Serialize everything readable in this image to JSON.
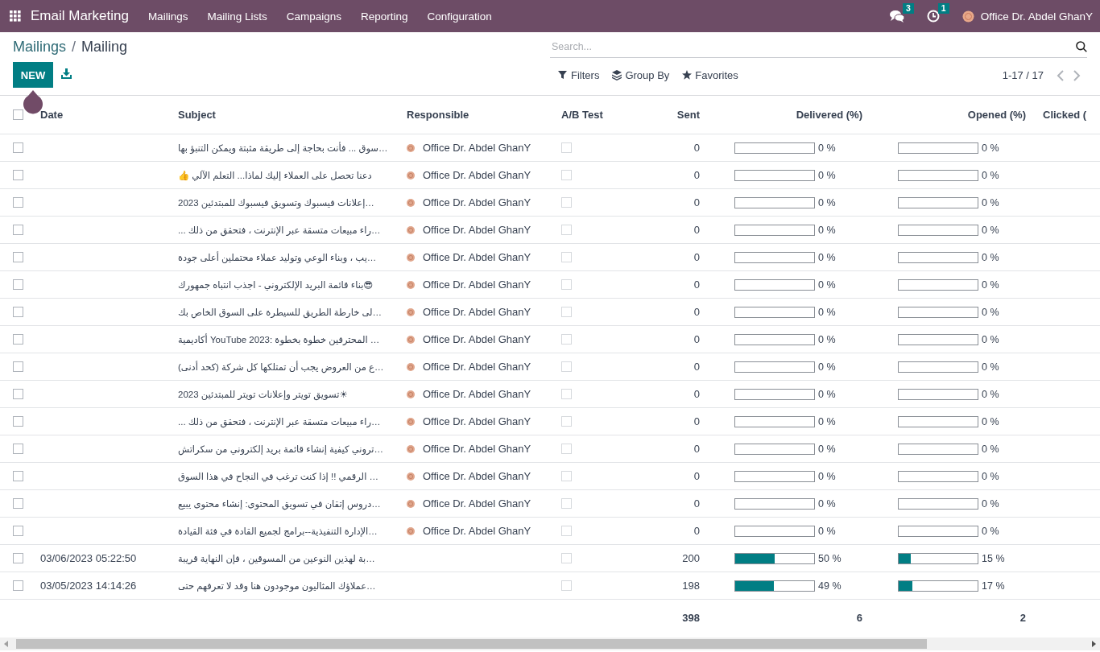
{
  "app": {
    "name": "Email Marketing"
  },
  "menu": [
    "Mailings",
    "Mailing Lists",
    "Campaigns",
    "Reporting",
    "Configuration"
  ],
  "systray": {
    "messages_count": "3",
    "activities_count": "1",
    "user": "Office Dr. Abdel GhanY"
  },
  "breadcrumb": {
    "parent": "Mailings",
    "separator": "/",
    "current": "Mailing"
  },
  "new_button": "NEW",
  "search": {
    "placeholder": "Search..."
  },
  "search_options": [
    {
      "kind": "filter",
      "label": "Filters"
    },
    {
      "kind": "group",
      "label": "Group By"
    },
    {
      "kind": "favorite",
      "label": "Favorites"
    }
  ],
  "pager": "1-17 / 17",
  "table": {
    "header_selected": false,
    "columns": [
      "Date",
      "Subject",
      "Responsible",
      "A/B Test",
      "Sent",
      "Delivered (%)",
      "Opened (%)",
      "Clicked ("
    ],
    "rows": [
      {
        "selected": false,
        "subject": "…سوق ... فأنت بحاجة إلى طريقة مثبتة ويمكن التنبؤ بها",
        "responsible": "Office Dr. Abdel GhanY",
        "ab_test": false,
        "sent": "0",
        "delivered": {
          "level": 0,
          "text": "0 %"
        },
        "opened": {
          "level": 0,
          "text": "0 %"
        }
      },
      {
        "selected": false,
        "subject": "دعنا تحصل على العملاء إليك لماذا... التعلم الآلي 👍",
        "responsible": "Office Dr. Abdel GhanY",
        "ab_test": false,
        "sent": "0",
        "delivered": {
          "level": 0,
          "text": "0 %"
        },
        "opened": {
          "level": 0,
          "text": "0 %"
        }
      },
      {
        "selected": false,
        "subject": "…إعلانات فيسبوك وتسويق فيسبوك للمبتدئين 2023",
        "responsible": "Office Dr. Abdel GhanY",
        "ab_test": false,
        "sent": "0",
        "delivered": {
          "level": 0,
          "text": "0 %"
        },
        "opened": {
          "level": 0,
          "text": "0 %"
        }
      },
      {
        "selected": false,
        "subject": "…راء مبيعات متسقة عبر الإنترنت ، فتحقق من ذلك ...",
        "responsible": "Office Dr. Abdel GhanY",
        "ab_test": false,
        "sent": "0",
        "delivered": {
          "level": 0,
          "text": "0 %"
        },
        "opened": {
          "level": 0,
          "text": "0 %"
        }
      },
      {
        "selected": false,
        "subject": "…يب ، وبناء الوعي وتوليد عملاء محتملين أعلى جودة",
        "responsible": "Office Dr. Abdel GhanY",
        "ab_test": false,
        "sent": "0",
        "delivered": {
          "level": 0,
          "text": "0 %"
        },
        "opened": {
          "level": 0,
          "text": "0 %"
        }
      },
      {
        "selected": false,
        "subject": "😎بناء قائمة البريد الإلكتروني - اجذب انتباه جمهورك",
        "responsible": "Office Dr. Abdel GhanY",
        "ab_test": false,
        "sent": "0",
        "delivered": {
          "level": 0,
          "text": "0 %"
        },
        "opened": {
          "level": 0,
          "text": "0 %"
        }
      },
      {
        "selected": false,
        "subject": "…لى خارطة الطريق للسيطرة على السوق الخاص بك",
        "responsible": "Office Dr. Abdel GhanY",
        "ab_test": false,
        "sent": "0",
        "delivered": {
          "level": 0,
          "text": "0 %"
        },
        "opened": {
          "level": 0,
          "text": "0 %"
        }
      },
      {
        "selected": false,
        "subject": "… المحترفين خطوة بخطوة :YouTube 2023 أكاديمية",
        "responsible": "Office Dr. Abdel GhanY",
        "ab_test": false,
        "sent": "0",
        "delivered": {
          "level": 0,
          "text": "0 %"
        },
        "opened": {
          "level": 0,
          "text": "0 %"
        }
      },
      {
        "selected": false,
        "subject": "…ع من العروض يجب أن تمتلكها كل شركة (كحد أدنى)",
        "responsible": "Office Dr. Abdel GhanY",
        "ab_test": false,
        "sent": "0",
        "delivered": {
          "level": 0,
          "text": "0 %"
        },
        "opened": {
          "level": 0,
          "text": "0 %"
        }
      },
      {
        "selected": false,
        "subject": "☀تسويق تويتر وإعلانات تويتر للمبتدئين 2023",
        "responsible": "Office Dr. Abdel GhanY",
        "ab_test": false,
        "sent": "0",
        "delivered": {
          "level": 0,
          "text": "0 %"
        },
        "opened": {
          "level": 0,
          "text": "0 %"
        }
      },
      {
        "selected": false,
        "subject": "…راء مبيعات متسقة عبر الإنترنت ، فتحقق من ذلك ...",
        "responsible": "Office Dr. Abdel GhanY",
        "ab_test": false,
        "sent": "0",
        "delivered": {
          "level": 0,
          "text": "0 %"
        },
        "opened": {
          "level": 0,
          "text": "0 %"
        }
      },
      {
        "selected": false,
        "subject": "…تروني كيفية إنشاء قائمة بريد إلكتروني من سكراتش",
        "responsible": "Office Dr. Abdel GhanY",
        "ab_test": false,
        "sent": "0",
        "delivered": {
          "level": 0,
          "text": "0 %"
        },
        "opened": {
          "level": 0,
          "text": "0 %"
        }
      },
      {
        "selected": false,
        "subject": "… الرقمي !! إذا كنت ترغب في النجاح في هذا السوق",
        "responsible": "Office Dr. Abdel GhanY",
        "ab_test": false,
        "sent": "0",
        "delivered": {
          "level": 0,
          "text": "0 %"
        },
        "opened": {
          "level": 0,
          "text": "0 %"
        }
      },
      {
        "selected": false,
        "subject": "…دروس إتقان في تسويق المحتوى: إنشاء محتوى يبيع",
        "responsible": "Office Dr. Abdel GhanY",
        "ab_test": false,
        "sent": "0",
        "delivered": {
          "level": 0,
          "text": "0 %"
        },
        "opened": {
          "level": 0,
          "text": "0 %"
        }
      },
      {
        "selected": false,
        "subject": "…الإدارة التنفيذية--برامج لجميع القادة في فئة القيادة",
        "responsible": "Office Dr. Abdel GhanY",
        "ab_test": false,
        "sent": "0",
        "delivered": {
          "level": 0,
          "text": "0 %"
        },
        "opened": {
          "level": 0,
          "text": "0 %"
        }
      },
      {
        "selected": false,
        "date": "03/06/2023 05:22:50",
        "subject": "…بة لهذين النوعين من المسوقين ، فإن النهاية قريبة",
        "ab_test": false,
        "sent": "200",
        "delivered": {
          "level": 0.5,
          "text": "50 %"
        },
        "opened": {
          "level": 0.15,
          "text": "15 %"
        }
      },
      {
        "selected": false,
        "date": "03/05/2023 14:14:26",
        "subject": "…عملاؤك المثاليون موجودون هنا وقد لا تعرفهم حتى",
        "ab_test": false,
        "sent": "198",
        "delivered": {
          "level": 0.49,
          "text": "49 %"
        },
        "opened": {
          "level": 0.17,
          "text": "17 %"
        }
      }
    ],
    "totals": {
      "sent": "398",
      "delivered": "6",
      "opened": "2"
    }
  }
}
